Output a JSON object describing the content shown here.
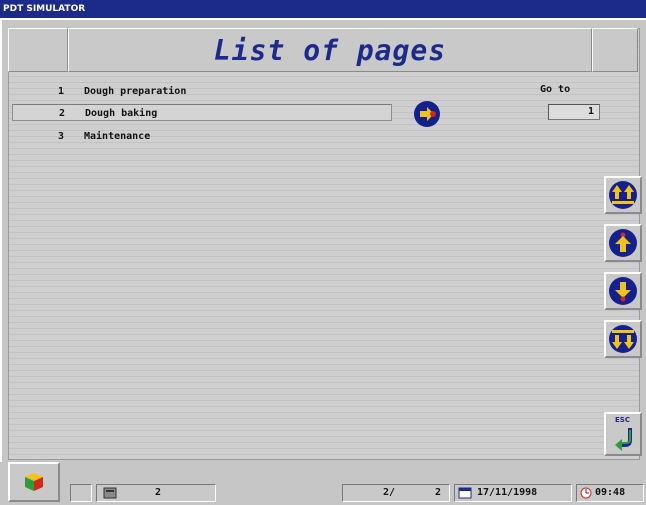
{
  "window": {
    "title": "PDT SIMULATOR"
  },
  "header": {
    "title": "List of pages"
  },
  "pages": [
    {
      "number": "1",
      "label": "Dough preparation"
    },
    {
      "number": "2",
      "label": "Dough baking"
    },
    {
      "number": "3",
      "label": "Maintenance"
    }
  ],
  "goto": {
    "label": "Go to",
    "value": "1"
  },
  "status": {
    "message_count": "2",
    "page_indicator": "2/",
    "page_total": "2",
    "date": "17/11/1998",
    "time": "09:48"
  },
  "esc_label": "ESC",
  "icons": {
    "selected_arrow": "arrow-right-in-circle-icon",
    "nav": [
      "page-up-icon",
      "line-up-icon",
      "line-down-icon",
      "page-down-icon"
    ],
    "esc": "esc-return-icon",
    "cube": "cube-icon",
    "message": "message-icon",
    "calendar": "calendar-icon",
    "clock": "clock-icon"
  },
  "colors": {
    "titlebar": "#1c2a8a",
    "title_text": "#1c2a8a",
    "icon_disc": "#14208c",
    "icon_arrow": "#f2c21c"
  }
}
